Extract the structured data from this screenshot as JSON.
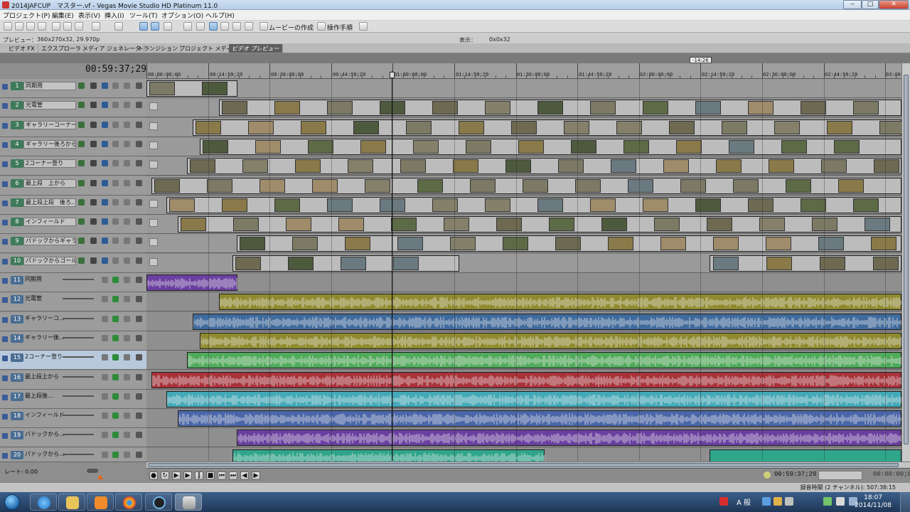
{
  "window": {
    "title": "2014JAFCUP　マスター.vf - Vegas Movie Studio HD Platinum 11.0",
    "min": "‒",
    "max": "□",
    "close": "✕"
  },
  "menu": [
    "プロジェクト(P)",
    "編集(E)",
    "表示(V)",
    "挿入(I)",
    "ツール(T)",
    "オプション(O)",
    "ヘルプ(H)"
  ],
  "toolbar": {
    "make_movie": "ムービーの作成",
    "guide": "操作手順"
  },
  "dock_info": {
    "preview_label": "プレビュー：",
    "preview_value": "360x270x32, 29.970p",
    "display_label": "表示：",
    "display_value": "0x0x32"
  },
  "tabs": [
    "ビデオ FX",
    "エクスプローラ",
    "メディア ジェネレータ",
    "トランジション",
    "プロジェクト メディア",
    "ビデオ プレビュー"
  ],
  "timeline": {
    "marker_flag": "-14:26",
    "current_time": "00:59:37;29",
    "ruler": [
      "00:00:00;00",
      "00:14:59;29",
      "00:30:00;00",
      "00:44:59;29",
      "01:00:00;00",
      "01:14:59;29",
      "01:30:00;00",
      "01:44:59;29",
      "02:00:00;00",
      "02:14:59;29",
      "02:30:00;00",
      "02:44:59;29",
      "03:00"
    ]
  },
  "tracks": [
    {
      "num": "1",
      "name": "同期用",
      "kind": "video"
    },
    {
      "num": "2",
      "name": "光電管",
      "kind": "video"
    },
    {
      "num": "3",
      "name": "ギャラリーコーナー",
      "kind": "video"
    },
    {
      "num": "4",
      "name": "ギャラリー後ろから",
      "kind": "video"
    },
    {
      "num": "5",
      "name": "2コーナー登り",
      "kind": "video"
    },
    {
      "num": "6",
      "name": "最上段　上から",
      "kind": "video"
    },
    {
      "num": "7",
      "name": "最上段上段　後ろ…",
      "kind": "video"
    },
    {
      "num": "8",
      "name": "インフィールド",
      "kind": "video"
    },
    {
      "num": "9",
      "name": "パドックからギャラリー",
      "kind": "video"
    },
    {
      "num": "10",
      "name": "パドックからゴール",
      "kind": "video"
    },
    {
      "num": "11",
      "name": "同期用",
      "kind": "audio"
    },
    {
      "num": "12",
      "name": "光電管",
      "kind": "audio"
    },
    {
      "num": "13",
      "name": "ギャラリーコ…",
      "kind": "audio"
    },
    {
      "num": "14",
      "name": "ギャラリー後…",
      "kind": "audio"
    },
    {
      "num": "15",
      "name": "2コーナー登り",
      "kind": "audio"
    },
    {
      "num": "16",
      "name": "最上段上から",
      "kind": "audio"
    },
    {
      "num": "17",
      "name": "最上段後…",
      "kind": "audio"
    },
    {
      "num": "18",
      "name": "インフィールド",
      "kind": "audio"
    },
    {
      "num": "19",
      "name": "パドックから…",
      "kind": "audio"
    },
    {
      "num": "20",
      "name": "パドックから…",
      "kind": "audio"
    }
  ],
  "rate": {
    "label": "レート: 0.00"
  },
  "transport": {
    "timecode": "00:59:37;29",
    "timecode2": "00:00:00;04"
  },
  "status": {
    "record_time": "録音時間 (2 チャンネル): 507:38:15"
  },
  "taskbar": {
    "ime": "A 般",
    "time": "18:07",
    "date": "2014/11/08"
  },
  "colors": {
    "video_clip": "#bcbcbc",
    "audio_11": "#6a3fa0",
    "audio_12": "#8f8a2e",
    "audio_13": "#3f6a9c",
    "audio_14": "#8f8a2e",
    "audio_15": "#4faa5a",
    "audio_16": "#a8323a",
    "audio_17": "#43a9b8",
    "audio_18": "#4a66a8",
    "audio_19": "#6a3fa0",
    "audio_20": "#2fa58a"
  }
}
